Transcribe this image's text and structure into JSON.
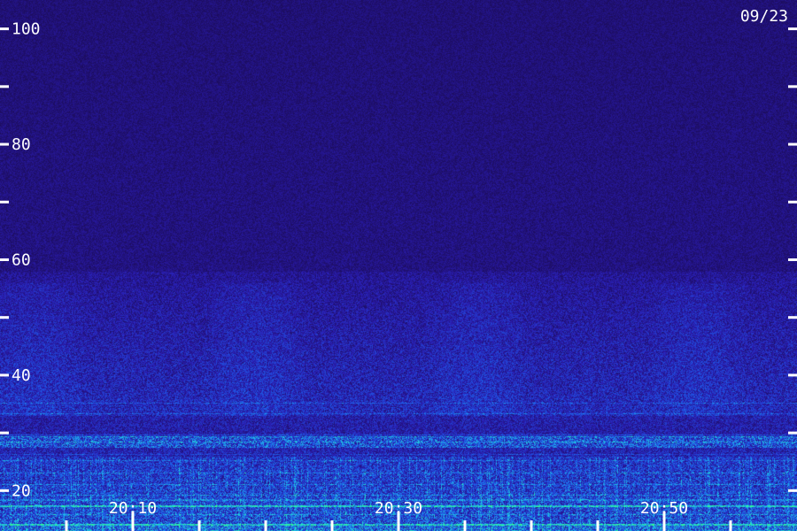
{
  "date_label": "09/23",
  "chart_data": {
    "type": "heatmap",
    "title": "",
    "xlabel": "",
    "ylabel": "",
    "ylim": [
      13,
      105
    ],
    "xlim": [
      "20:00",
      "21:00"
    ],
    "y_ticks_major": [
      20,
      40,
      60,
      80,
      100
    ],
    "y_tick_labels": [
      "20",
      "40",
      "60",
      "80",
      "100"
    ],
    "y_ticks_minor": [
      30,
      50,
      70,
      90
    ],
    "x_ticks_major": [
      "20:10",
      "20:30",
      "20:50"
    ],
    "x_tick_labels": [
      "20:10",
      "20:30",
      "20:50"
    ],
    "x_ticks_minor_every_minutes": 5,
    "colormap": [
      "#1a0a50",
      "#2a1cb0",
      "#1e5ae8",
      "#1fc8e8",
      "#30ff90"
    ],
    "noise_floor_color": "#241470",
    "features": [
      {
        "kind": "band",
        "y": [
          28,
          29
        ],
        "intensity": "high"
      },
      {
        "kind": "band",
        "y": [
          13,
          26
        ],
        "intensity": "high"
      },
      {
        "kind": "band",
        "y": [
          33,
          55
        ],
        "intensity": "medium"
      }
    ]
  }
}
